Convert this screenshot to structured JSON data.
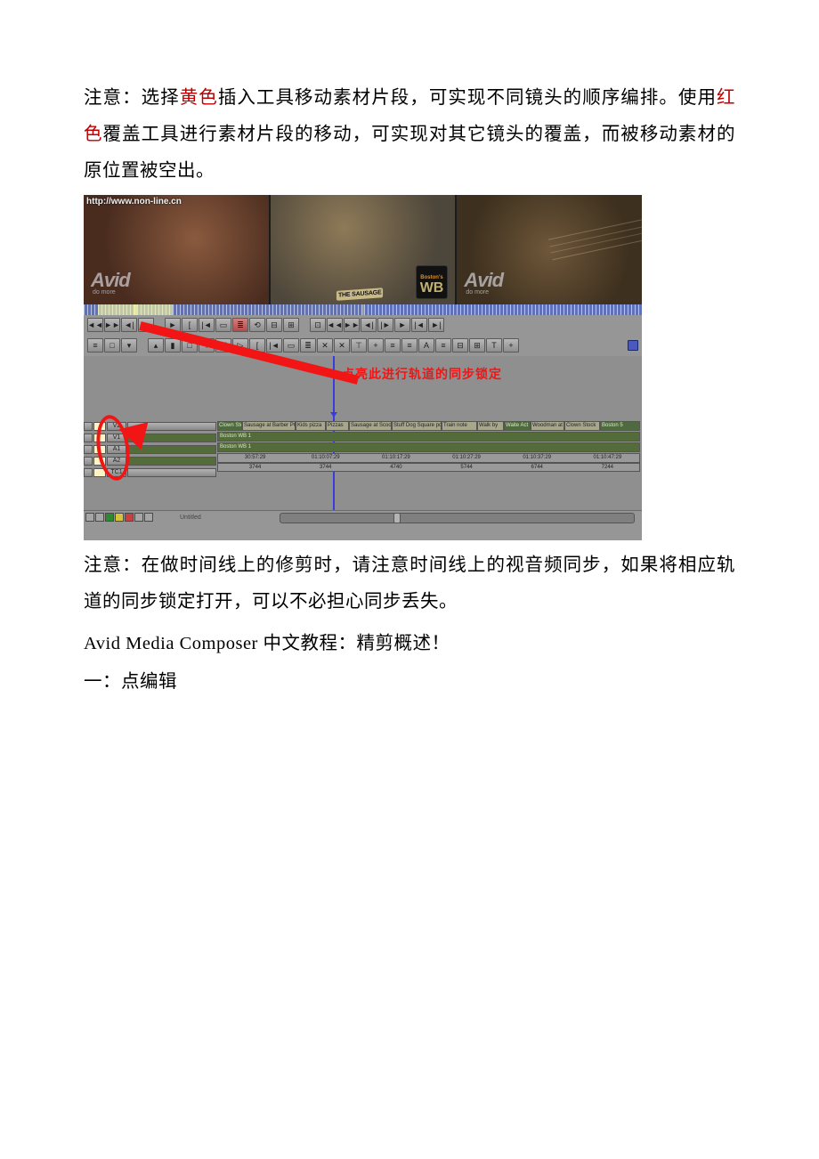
{
  "body": {
    "p1_prefix": "注意：选择",
    "p1_yellow": "黄色",
    "p1_mid": "插入工具移动素材片段，可实现不同镜头的顺序编排。使用",
    "p1_red": "红色",
    "p1_suffix": "覆盖工具进行素材片段的移动，可实现对其它镜头的覆盖，而被移动素材的原位置被空出。",
    "p2": "注意：在做时间线上的修剪时，请注意时间线上的视音频同步，如果将相应轨道的同步锁定打开，可以不必担心同步丢失。",
    "p3": "Avid Media Composer 中文教程：精剪概述！",
    "p4": "一：点编辑"
  },
  "shot": {
    "url": "http://www.non-line.cn",
    "avid_brand": "Avid",
    "avid_slogan": "do more",
    "wb_city": "Boston's",
    "wb_text": "WB",
    "sausage_label": "THE SAUSAGE",
    "annotation": "点亮此进行轨道的同步锁定",
    "v1_clips": [
      "Clown Sto",
      "Sausage at Barber POV",
      "Kids pizza",
      "Pizzas ",
      "Sausage at Scooter 1",
      "Stuff Dog Square po",
      "Train note",
      "Walk by",
      "Waite Act",
      "Woodman at",
      "Clown Stock",
      "Boston 5"
    ],
    "audio_label_1": "Boston WB 1",
    "audio_label_2": "Boston WB 1",
    "tc_top": [
      "30:57:29",
      "01:10:07:29",
      "01:10:17:29",
      "01:10:27:29",
      "01:10:37:29",
      "01:10:47:29"
    ],
    "tc_sub": [
      "3744",
      "3744",
      "4740",
      "5744",
      "6744",
      "7244"
    ],
    "track_names": {
      "v2": "V2",
      "v1": "V1",
      "a1": "A1",
      "a2": "A2",
      "tc1": "TC1"
    },
    "tb1": [
      "◄◄",
      "►►",
      "◄|",
      "|►",
      "►",
      " ",
      "[",
      "|◄",
      "▭",
      "≣",
      "⟲",
      "⊟",
      "⊞",
      "⊡",
      " ",
      "◄◄",
      "►►",
      "◄|",
      "|►",
      "►",
      "|◄",
      "►|"
    ],
    "tb2": [
      "≡",
      "□",
      "▾",
      " ",
      "▴",
      "▮",
      "□",
      "⊤",
      "Ø",
      "▷",
      "[",
      "|◄",
      "▭",
      "≣",
      "✕",
      "✕",
      "⊤",
      "+",
      "≡",
      "≡",
      "A",
      "≡",
      "⊟",
      "⊞",
      "T",
      "+"
    ],
    "untitled": "Untitled"
  }
}
